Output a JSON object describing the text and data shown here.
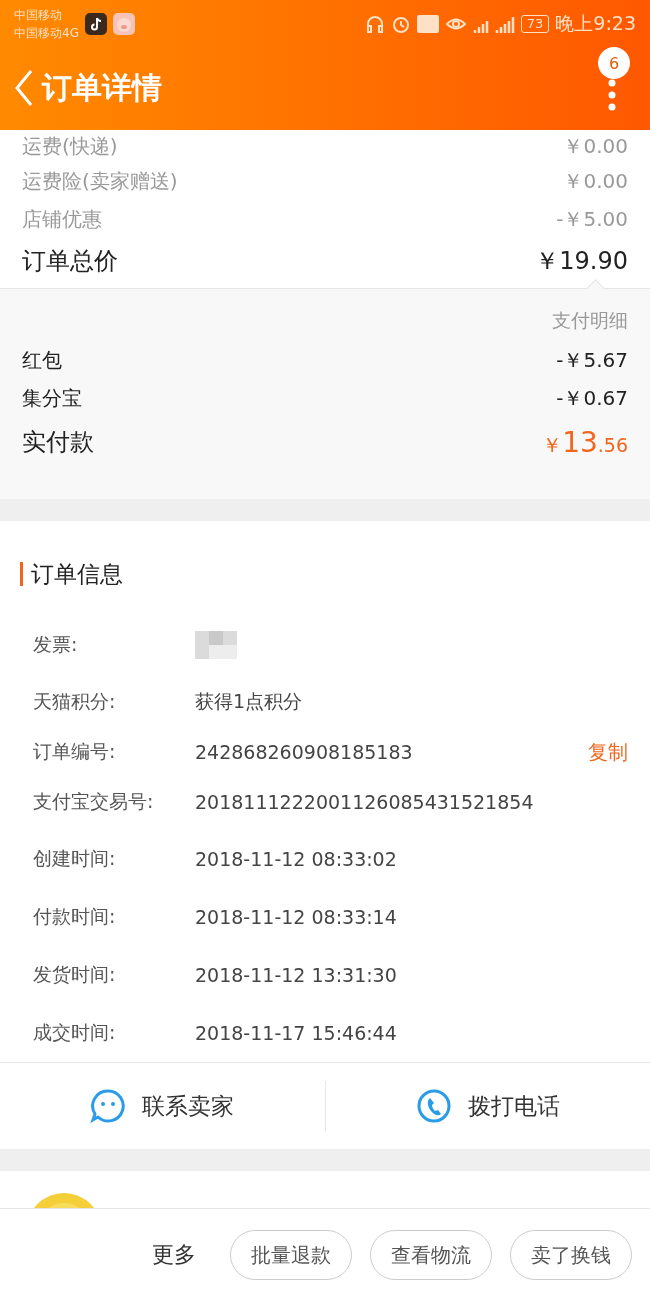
{
  "status_bar": {
    "carriers": [
      "中国移动",
      "中国移动4G"
    ],
    "battery": "73",
    "time": "晚上9:23"
  },
  "header": {
    "title": "订单详情",
    "badge": "6"
  },
  "costs": [
    {
      "label": "运费(快递)",
      "value": "￥0.00"
    },
    {
      "label": "运费险(卖家赠送)",
      "value": "￥0.00"
    },
    {
      "label": "店铺优惠",
      "value": "-￥5.00"
    }
  ],
  "total": {
    "label": "订单总价",
    "value": "￥19.90"
  },
  "payment": {
    "title": "支付明细",
    "items": [
      {
        "label": "红包",
        "value": "-￥5.67"
      },
      {
        "label": "集分宝",
        "value": "-￥0.67"
      }
    ],
    "paid": {
      "label": "实付款",
      "currency": "￥",
      "integer": "13",
      "decimal": ".56"
    }
  },
  "order_info": {
    "title": "订单信息",
    "rows": [
      {
        "kind": "redacted",
        "label": "发票:"
      },
      {
        "kind": "text",
        "label": "天猫积分:",
        "value": "获得1点积分"
      },
      {
        "kind": "copy",
        "label": "订单编号:",
        "value": "242868260908185183",
        "action": "复制"
      },
      {
        "kind": "text",
        "label": "支付宝交易号:",
        "value": "2018111222001126085431521854"
      },
      {
        "kind": "text",
        "label": "创建时间:",
        "value": "2018-11-12 08:33:02"
      },
      {
        "kind": "text",
        "label": "付款时间:",
        "value": "2018-11-12 08:33:14"
      },
      {
        "kind": "text",
        "label": "发货时间:",
        "value": "2018-11-12 13:31:30"
      },
      {
        "kind": "text",
        "label": "成交时间:",
        "value": "2018-11-17 15:46:44"
      }
    ]
  },
  "contact": [
    {
      "kind": "chat",
      "label": "联系卖家"
    },
    {
      "kind": "phone",
      "label": "拨打电话"
    }
  ],
  "bottom_bar": {
    "more": "更多",
    "buttons": [
      "批量退款",
      "查看物流",
      "卖了换钱"
    ]
  }
}
